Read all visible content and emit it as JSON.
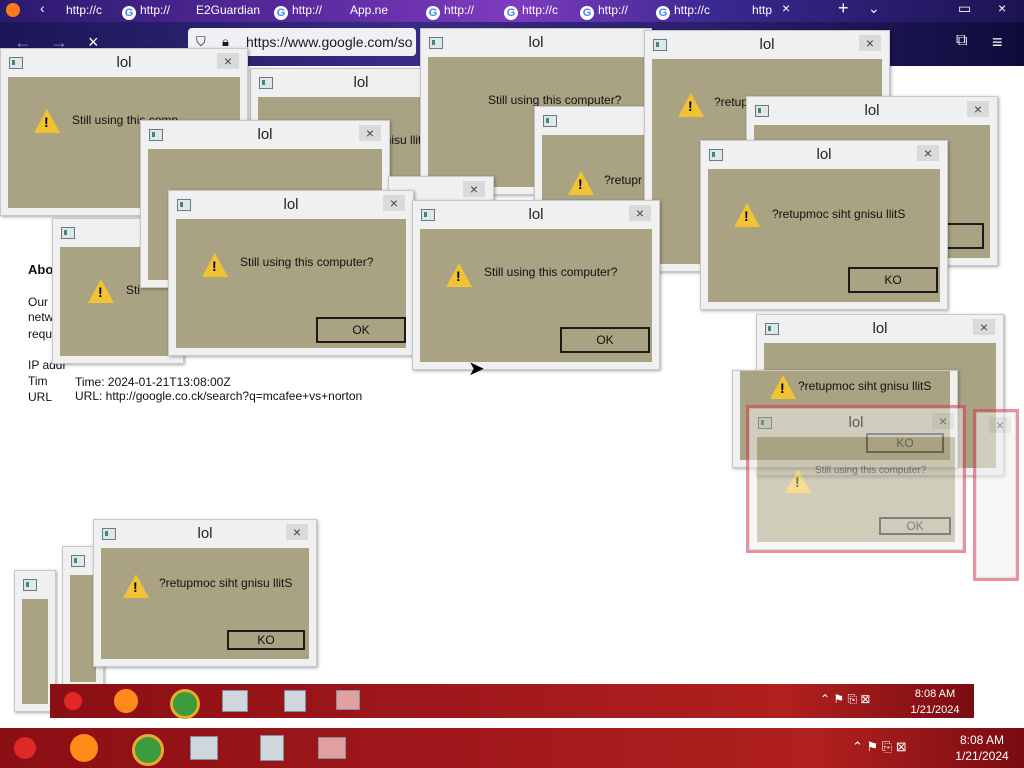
{
  "browser": {
    "tabs": [
      "http://c",
      "http://",
      "E2Guardian",
      "http://",
      "App.ne",
      "http://",
      "http://c",
      "http://",
      "http://c",
      "http"
    ],
    "url": "https://www.google.com/so"
  },
  "page": {
    "heading": "Abo",
    "lines": [
      "Our",
      "netw",
      "requ"
    ],
    "ip_label": "IP addr",
    "time_short": "Tim",
    "url_short": "URL",
    "time_line": "Time: 2024-01-21T13:08:00Z",
    "url_line": "URL: http://google.co.ck/search?q=mcafee+vs+norton"
  },
  "dialog": {
    "title": "lol",
    "msg": "Still using this computer?",
    "msg_reversed": "?retupmoc siht gnisu llitS",
    "msg_reversed_partial": "?retupr",
    "msg_clip_a": "Still using this comp",
    "msg_clip_b": "Sti",
    "msg_clip_c": "gnisu llitS",
    "ok": "OK",
    "ok_reversed": "KO",
    "close": "×"
  },
  "taskbar": {
    "time": "8:08 AM",
    "date": "1/21/2024"
  },
  "colors": {
    "dialog_body": "#a9a383",
    "taskbar": "#a3191c",
    "warning": "#f1c232"
  }
}
